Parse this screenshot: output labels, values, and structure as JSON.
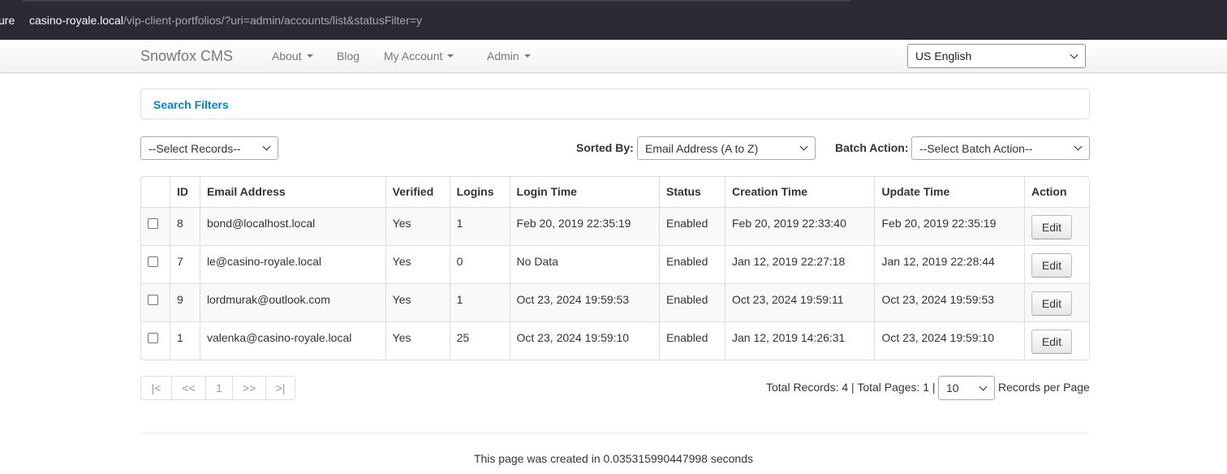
{
  "browser": {
    "security_fragment": "ure",
    "url_host": "casino-royale.local",
    "url_path": "/vip-client-portfolios/?uri=admin/accounts/list&statusFilter=y"
  },
  "navbar": {
    "brand": "Snowfox CMS",
    "items": [
      {
        "label": "About",
        "dropdown": true
      },
      {
        "label": "Blog",
        "dropdown": false
      },
      {
        "label": "My Account",
        "dropdown": true
      },
      {
        "label": "Admin",
        "dropdown": true
      }
    ],
    "language": "US English"
  },
  "filters": {
    "title": "Search Filters"
  },
  "controls": {
    "records_select": "--Select Records--",
    "sorted_by_label": "Sorted By:",
    "sorted_by_value": "Email Address (A to Z)",
    "batch_action_label": "Batch Action:",
    "batch_action_value": "--Select Batch Action--"
  },
  "table": {
    "headers": [
      "ID",
      "Email Address",
      "Verified",
      "Logins",
      "Login Time",
      "Status",
      "Creation Time",
      "Update Time",
      "Action"
    ],
    "rows": [
      {
        "id": "8",
        "email": "bond@localhost.local",
        "verified": "Yes",
        "logins": "1",
        "login_time": "Feb 20, 2019 22:35:19",
        "status": "Enabled",
        "created": "Feb 20, 2019 22:33:40",
        "updated": "Feb 20, 2019 22:35:19",
        "action": "Edit"
      },
      {
        "id": "7",
        "email": "le@casino-royale.local",
        "verified": "Yes",
        "logins": "0",
        "login_time": "No Data",
        "status": "Enabled",
        "created": "Jan 12, 2019 22:27:18",
        "updated": "Jan 12, 2019 22:28:44",
        "action": "Edit"
      },
      {
        "id": "9",
        "email": "lordmurak@outlook.com",
        "verified": "Yes",
        "logins": "1",
        "login_time": "Oct 23, 2024 19:59:53",
        "status": "Enabled",
        "created": "Oct 23, 2024 19:59:11",
        "updated": "Oct 23, 2024 19:59:53",
        "action": "Edit"
      },
      {
        "id": "1",
        "email": "valenka@casino-royale.local",
        "verified": "Yes",
        "logins": "25",
        "login_time": "Oct 23, 2024 19:59:10",
        "status": "Enabled",
        "created": "Jan 12, 2019 14:26:31",
        "updated": "Oct 23, 2024 19:59:10",
        "action": "Edit"
      }
    ]
  },
  "pagination": {
    "first": "|<",
    "prev": "<<",
    "current": "1",
    "next": ">>",
    "last": ">|",
    "totals_text": "Total Records: 4 | Total Pages: 1 |",
    "per_page": "10",
    "per_page_label": "Records per Page"
  },
  "footer": {
    "text": "This page was created in 0.035315990447998 seconds"
  }
}
